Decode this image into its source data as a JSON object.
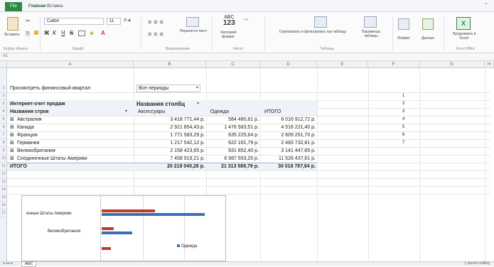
{
  "tabs": {
    "file": "File",
    "home": "Главная",
    "insert": "Вставка"
  },
  "ribbon": {
    "paste": "Вставить",
    "font": "Calibri",
    "size": "11",
    "bold": "Ж",
    "italic": "К",
    "underline": "Ч",
    "strike": "S",
    "wrap": "Перенести текст",
    "numfmt": "Числовой формат",
    "sortfilter": "Сортировать и фильтровать как таблицу",
    "params": "Параметры таблицы",
    "fmt": "Формат",
    "data": "Данные",
    "excel": "Продолжить в Excel",
    "g_clip": "Буфер обмена",
    "g_font": "Шрифт",
    "g_align": "Выравнивание",
    "g_num": "Число",
    "g_tables": "Таблицы",
    "g_office": "Excel Office"
  },
  "formula_bar": {
    "cell": "A1"
  },
  "columns": [
    "A",
    "B",
    "C",
    "D",
    "E",
    "F",
    "G",
    "H"
  ],
  "rows": [
    "1",
    "2",
    "3",
    "4",
    "5",
    "6",
    "7",
    "8",
    "9",
    "10",
    "11",
    "12",
    "13",
    "14",
    "15",
    "16",
    "17"
  ],
  "pivot": {
    "filter_label": "Просмотреть финансовый квартал",
    "filter_value": "Все периоды",
    "value_label": "Интернет-счет продаж",
    "col_labels": "Названия столбц",
    "row_labels": "Названия строк",
    "col_headers": [
      "Аксессуары",
      "Одежда",
      "ИТОГО"
    ],
    "rows": [
      {
        "name": "Австралия",
        "v": [
          "3 418 771,44 р.",
          "584 480,81 р.",
          "6 016 912,72 р."
        ]
      },
      {
        "name": "Канада",
        "v": [
          "2 921 854,43 р.",
          "1 476 583,51 р.",
          "4 516 221,40 р."
        ]
      },
      {
        "name": "Франция",
        "v": [
          "1 771 583,29 р.",
          "635 225,64 р.",
          "2 609 251,70 р."
        ]
      },
      {
        "name": "Германия",
        "v": [
          "1 217 542,12 р.",
          "622 161,79 р.",
          "2 483 732,81 р."
        ]
      },
      {
        "name": "Великобритания",
        "v": [
          "2 158 423,65 р.",
          "931 852,40 р.",
          "3 141 447,85 р."
        ]
      },
      {
        "name": "Соединенные Штаты Америки",
        "v": [
          "7 458 919,21 р.",
          "6 987 553,20 р.",
          "11 526 437,61 р."
        ]
      }
    ],
    "total_label": "ИТОГО",
    "totals": [
      "20 218 040,26 р.",
      "21 313 589,79 р.",
      "30 018 787,64 р."
    ]
  },
  "side_numbers": [
    "1",
    "2",
    "3",
    "4",
    "5",
    "6",
    "7"
  ],
  "chart": {
    "cat1": "енные Штаты Америки",
    "cat2": "Великобритания",
    "legend": "Одежда",
    "legend_color": "#3a6fb7",
    "series_color": "#c0392b"
  },
  "sheet": {
    "tab": "AWC",
    "status": "1 person editing"
  }
}
